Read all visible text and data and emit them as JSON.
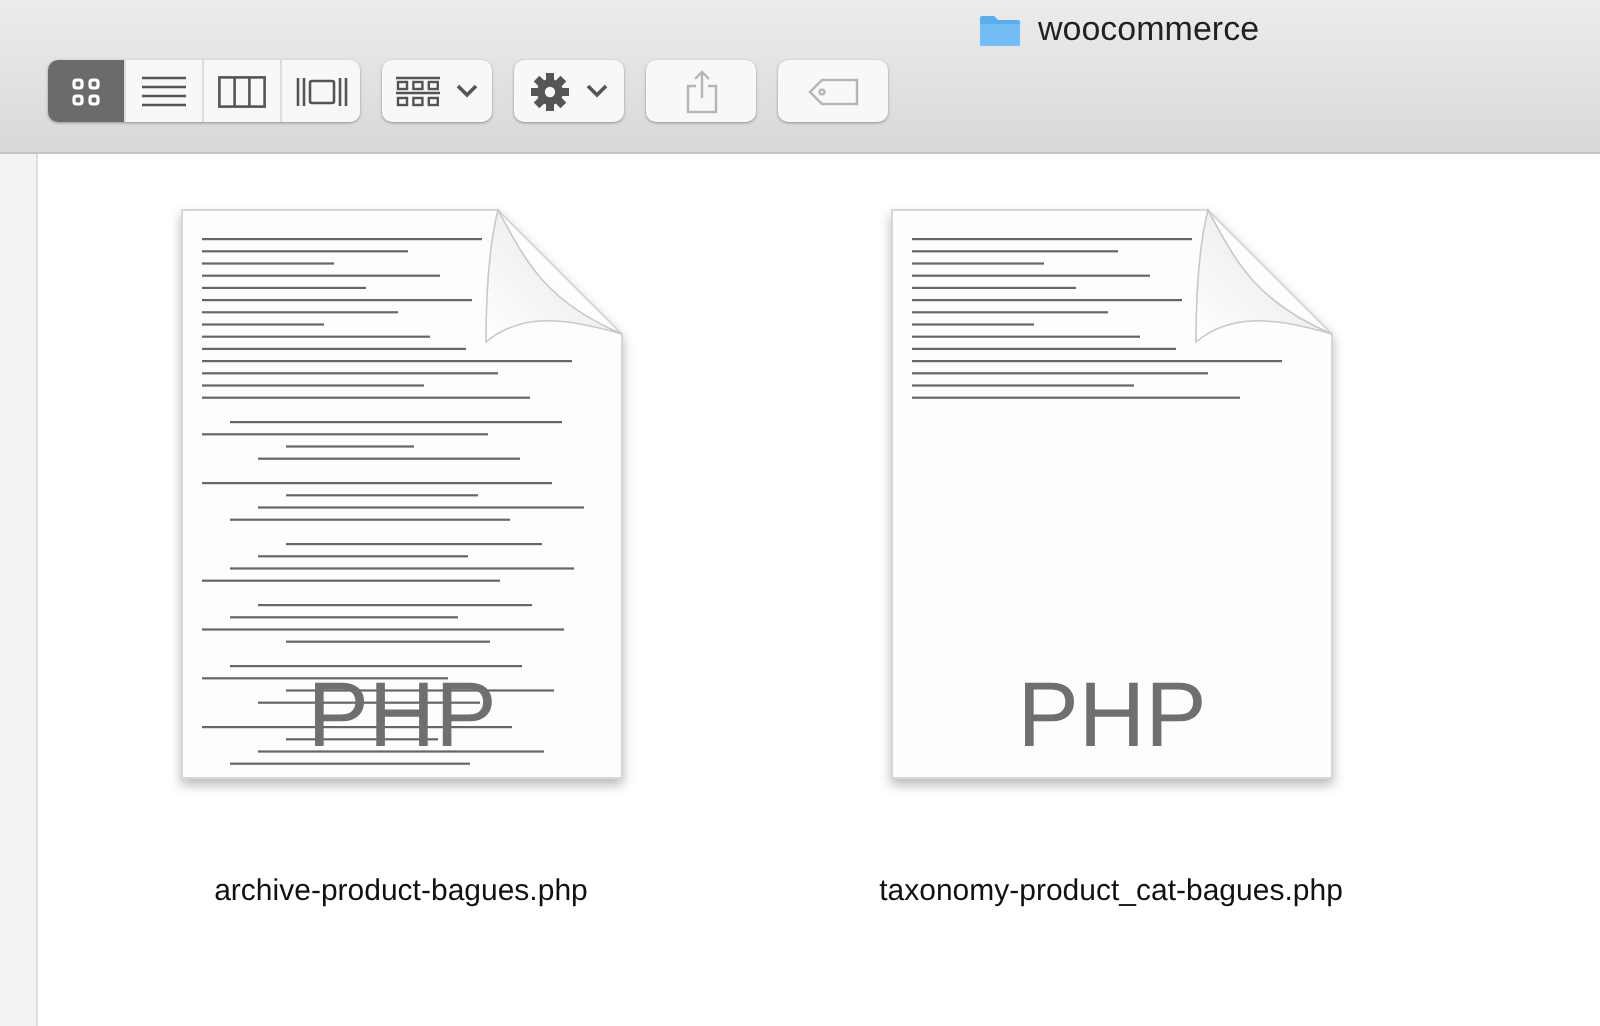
{
  "window": {
    "title": "woocommerce"
  },
  "toolbar": {
    "view_modes": [
      {
        "kind": "icons",
        "selected": true
      },
      {
        "kind": "list",
        "selected": false
      },
      {
        "kind": "columns",
        "selected": false
      },
      {
        "kind": "gallery",
        "selected": false
      }
    ],
    "buttons": [
      {
        "kind": "arrange",
        "disabled": false
      },
      {
        "kind": "action",
        "disabled": false
      },
      {
        "kind": "share",
        "disabled": true
      },
      {
        "kind": "tags",
        "disabled": true
      }
    ]
  },
  "files": [
    {
      "name": "archive-product-bagues.php",
      "badge": "PHP",
      "kind": "long"
    },
    {
      "name": "taxonomy-product_cat-bagues.php",
      "badge": "PHP",
      "kind": "short"
    }
  ]
}
